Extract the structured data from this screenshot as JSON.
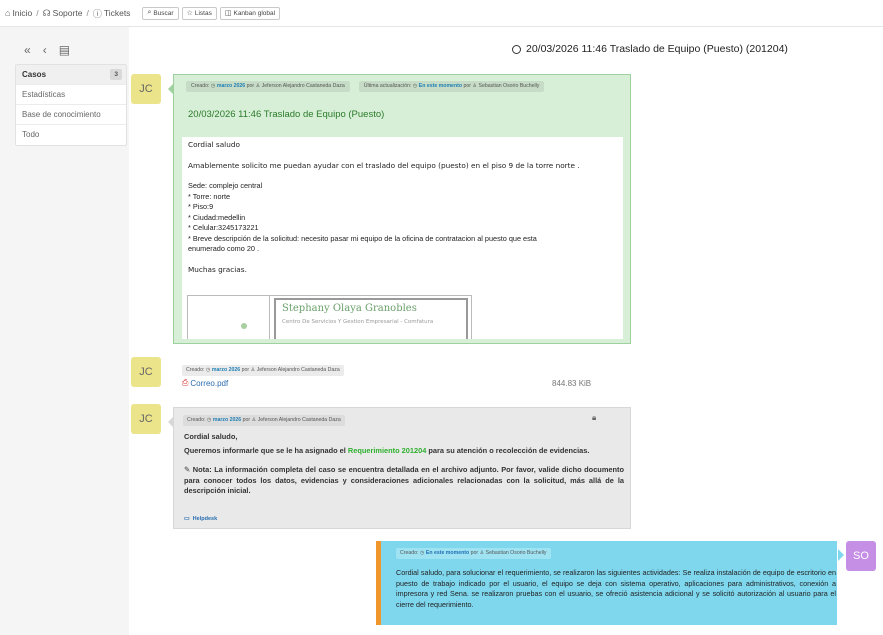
{
  "breadcrumb": {
    "home": "Inicio",
    "support": "Soporte",
    "tickets": "Tickets"
  },
  "toolbar": {
    "search": "Buscar",
    "lists": "Listas",
    "kanban": "Kanban global"
  },
  "page_title": "20/03/2026 11:46 Traslado de Equipo (Puesto) (201204)",
  "menu": {
    "items": [
      {
        "label": "Casos",
        "badge": "3"
      },
      {
        "label": "Estadísticas"
      },
      {
        "label": "Base de conocimiento"
      },
      {
        "label": "Todo"
      }
    ]
  },
  "timeline": {
    "item1": {
      "avatar": "JC",
      "created_label": "Creado:",
      "created_date": "marzo 2026",
      "by": "por",
      "created_author": "Jeferson Alejandro Castaneda Daza",
      "update_label": "Última actualización:",
      "update_date": "En este momento",
      "update_author": "Sebastian Osorio Buchelly",
      "title": "20/03/2026 11:46 Traslado de Equipo (Puesto)",
      "body": {
        "greeting": "Cordial saludo",
        "request": "Amablemente solicito me puedan ayudar con el traslado del equipo (puesto) en el piso 9 de la torre norte .",
        "site": "Sede: complejo central",
        "tower": "* Torre: norte",
        "floor": "* Piso:9",
        "city": "* Ciudad:medellin",
        "phone": "* Celular:3245173221",
        "desc1": "* Breve descripción de la solicitud: necesito pasar mi equipo de la oficina de contratacion al puesto que esta",
        "desc2": "enumerado como 20 .",
        "thanks": "Muchas gracias.",
        "sig_name": "Stephany Olaya Granobles",
        "sig_sub": "Centro De Servicios Y Gestion Empresarial - Comfatura"
      }
    },
    "item2": {
      "avatar": "JC",
      "created_label": "Creado:",
      "created_date": "marzo 2026",
      "by": "por",
      "author": "Jeferson Alejandro Castaneda Daza",
      "file_name": "Correo.pdf",
      "file_size": "844.83 KiB"
    },
    "item3": {
      "avatar": "JC",
      "created_label": "Creado:",
      "created_date": "marzo 2026",
      "by": "por",
      "author": "Jeferson Alejandro Castaneda Daza",
      "line1": "Cordial saludo,",
      "line2_a": "Queremos informarle que se le ha asignado el",
      "line2_req": "Requerimiento 201204",
      "line2_b": "para su atención o recolección de evidencias.",
      "note": "Nota: La información completa del caso se encuentra detallada en el archivo adjunto. Por favor, valide dicho documento para conocer todos los datos, evidencias y consideraciones adicionales relacionadas con la solicitud, más allá de la descripción inicial.",
      "helpdesk": "Helpdesk"
    },
    "item4": {
      "avatar": "SO",
      "created_label": "Creado:",
      "created_date": "En este momento",
      "by": "por",
      "author": "Sebastian Osorio Buchelly",
      "text": "Cordial saludo, para solucionar el requerimiento, se realizaron las siguientes actividades: Se realiza instalación de equipo de escritorio en puesto de trabajo indicado por el usuario, el equipo se deja con sistema operativo, aplicaciones para administrativos, conexión a impresora y red Sena. se realizaron pruebas con el usuario, se ofreció asistencia adicional y se solicitó autorización al usuario para el cierre del requerimiento."
    }
  },
  "colors": {
    "followup_green": "#d6efd6",
    "task_grey": "#e9e9e9",
    "solution_blue": "#7fd7ee",
    "solution_accent": "#f0962a",
    "avatar_jc": "#ece48a",
    "avatar_so": "#c58fe6"
  }
}
